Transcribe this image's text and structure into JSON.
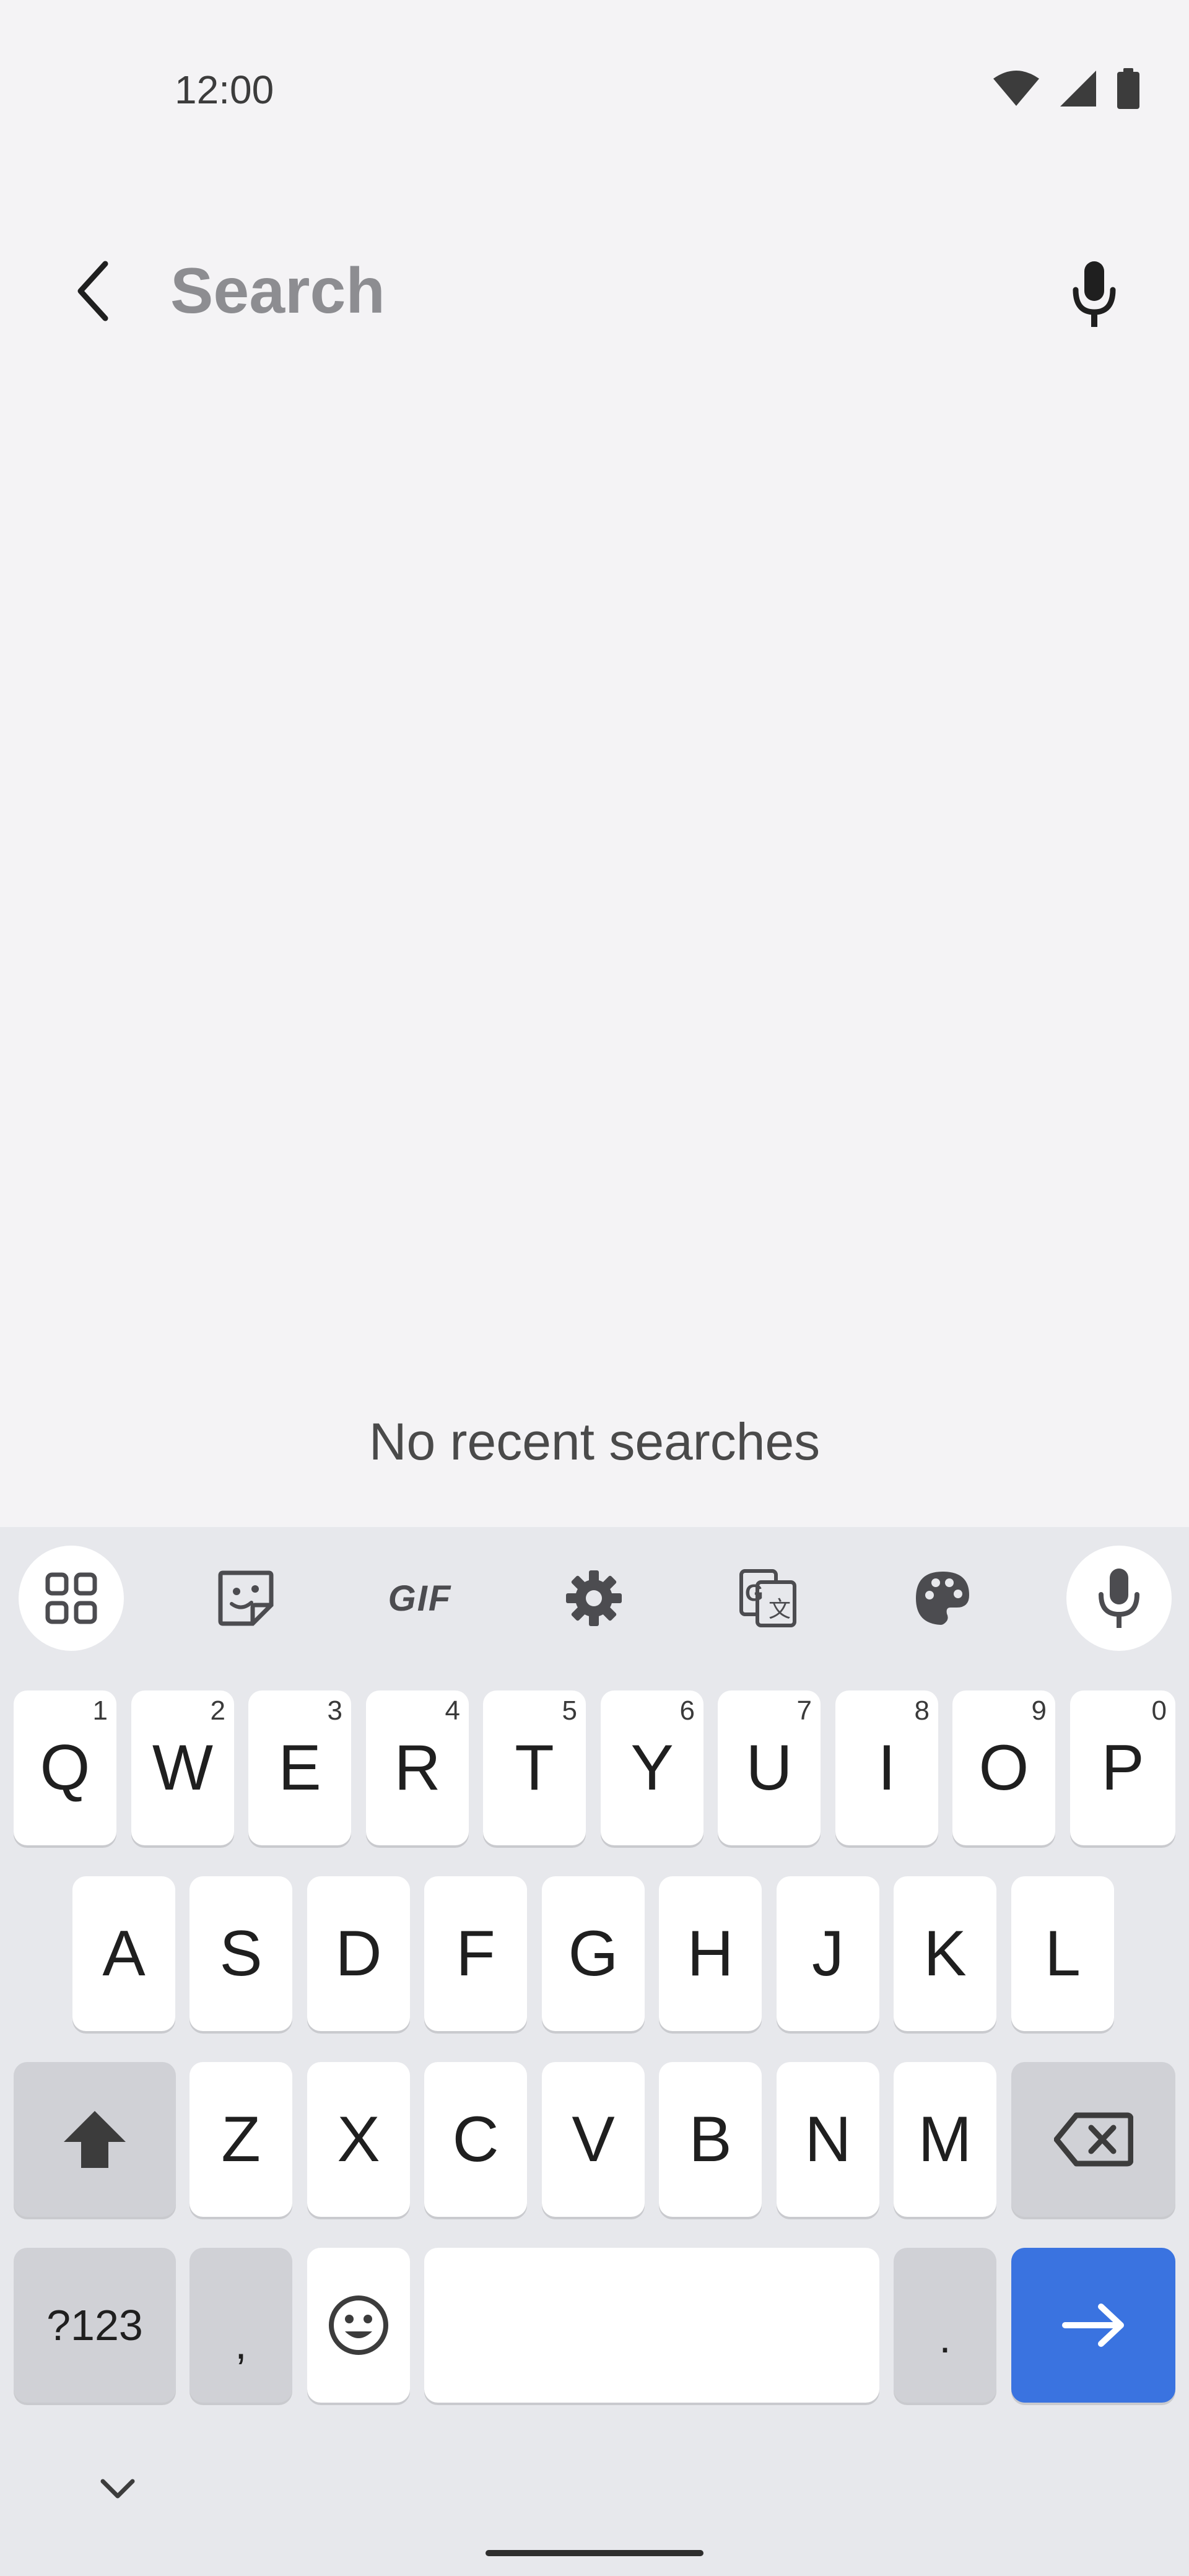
{
  "status_bar": {
    "time": "12:00",
    "icons": [
      "wifi-icon",
      "cellular-signal-icon",
      "battery-icon"
    ]
  },
  "search": {
    "placeholder": "Search",
    "value": "",
    "back_icon": "back-arrow-icon",
    "voice_icon": "microphone-icon"
  },
  "empty_state": {
    "message": "No recent searches"
  },
  "keyboard_toolbar": {
    "items": [
      "apps-grid-icon",
      "sticker-icon",
      "GIF",
      "settings-gear-icon",
      "translate-icon",
      "theme-palette-icon",
      "voice-input-icon"
    ],
    "gif_label": "GIF"
  },
  "keyboard": {
    "row1": [
      {
        "label": "Q",
        "hint": "1"
      },
      {
        "label": "W",
        "hint": "2"
      },
      {
        "label": "E",
        "hint": "3"
      },
      {
        "label": "R",
        "hint": "4"
      },
      {
        "label": "T",
        "hint": "5"
      },
      {
        "label": "Y",
        "hint": "6"
      },
      {
        "label": "U",
        "hint": "7"
      },
      {
        "label": "I",
        "hint": "8"
      },
      {
        "label": "O",
        "hint": "9"
      },
      {
        "label": "P",
        "hint": "0"
      }
    ],
    "row2": [
      "A",
      "S",
      "D",
      "F",
      "G",
      "H",
      "J",
      "K",
      "L"
    ],
    "row3": [
      "Z",
      "X",
      "C",
      "V",
      "B",
      "N",
      "M"
    ],
    "symbols_label": "?123",
    "comma_label": ",",
    "period_label": ".",
    "shift_icon": "shift-arrow-icon",
    "backspace_icon": "backspace-icon",
    "emoji_icon": "emoji-icon",
    "enter_icon": "arrow-right-icon"
  },
  "colors": {
    "background": "#f4f3f5",
    "keyboard_bg": "#e7e8ec",
    "action_key": "#3a73e0",
    "function_key": "#d0d1d6"
  }
}
